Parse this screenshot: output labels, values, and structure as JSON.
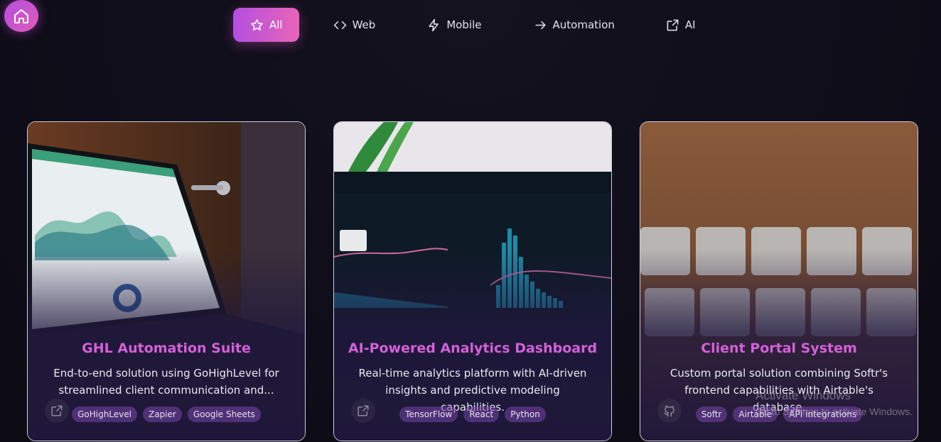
{
  "nav": {
    "items": [
      {
        "label": "All",
        "icon": "star-icon"
      },
      {
        "label": "Web",
        "icon": "code-icon"
      },
      {
        "label": "Mobile",
        "icon": "lightning-icon"
      },
      {
        "label": "Automation",
        "icon": "arrow-right-icon"
      },
      {
        "label": "AI",
        "icon": "external-link-icon"
      }
    ],
    "active": "All"
  },
  "home": {
    "icon": "home-icon"
  },
  "projects": [
    {
      "title": "GHL Automation Suite",
      "description": "End-to-end solution using GoHighLevel for streamlined client communication and...",
      "tags": [
        "GoHighLevel",
        "Zapier",
        "Google Sheets"
      ],
      "link_icon": "external-link-icon",
      "image": "laptop-dashboard-photo"
    },
    {
      "title": "AI-Powered Analytics Dashboard",
      "description": "Real-time analytics platform with AI-driven insights and predictive modeling capabilities.",
      "tags": [
        "TensorFlow",
        "React",
        "Python"
      ],
      "link_icon": "external-link-icon",
      "image": "analytics-screen-photo"
    },
    {
      "title": "Client Portal System",
      "description": "Custom portal solution combining Softr's frontend capabilities with Airtable's database.",
      "tags": [
        "Softr",
        "Airtable",
        "API integrations"
      ],
      "link_icon": "github-icon",
      "image": "letter-tiles-photo"
    }
  ],
  "watermark": {
    "title": "Activate Windows",
    "subtitle": "Go to Settings to activate Windows."
  },
  "colors": {
    "accent_start": "#b44fe0",
    "accent_end": "#e864b8",
    "title": "#d460d8",
    "background": "#0f0d19"
  }
}
